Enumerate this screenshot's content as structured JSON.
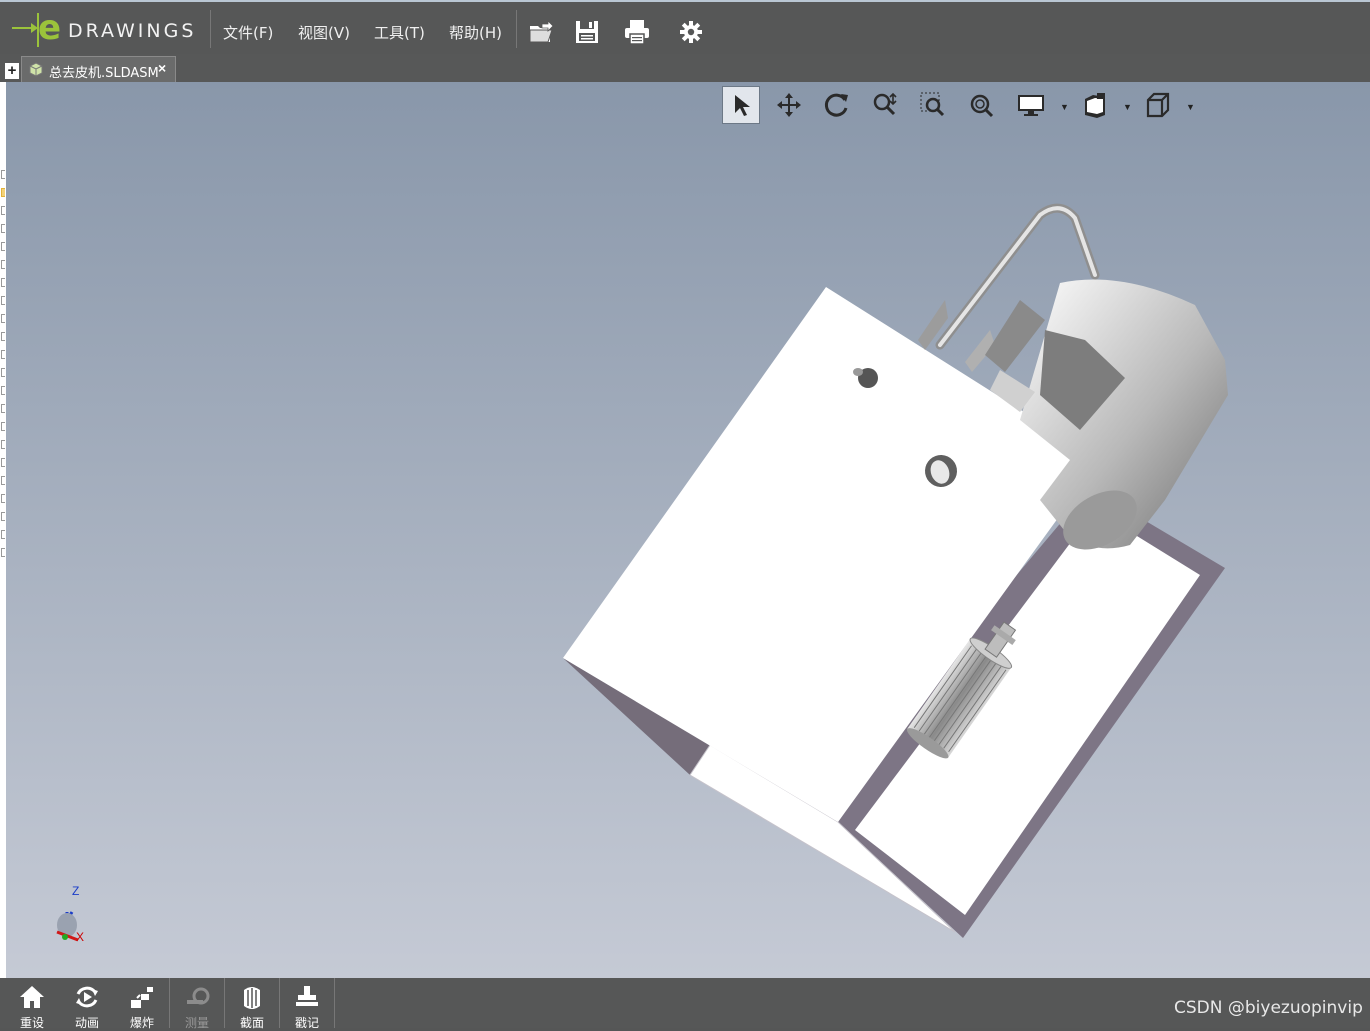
{
  "app": {
    "logo_text": "DRAWINGS"
  },
  "menu": {
    "file": "文件(F)",
    "view": "视图(V)",
    "tools": "工具(T)",
    "help": "帮助(H)"
  },
  "toolbar": {
    "icons": [
      "open-icon",
      "save-icon",
      "print-icon",
      "gear-icon"
    ]
  },
  "tabs": {
    "new_tab": "+",
    "document": "总去皮机.SLDASM",
    "close": "×"
  },
  "view_toolbar": {
    "icons": [
      "select-arrow-icon",
      "pan-icon",
      "rotate-icon",
      "zoom-icon",
      "zoom-to-area-icon",
      "zoom-to-fit-icon",
      "display-style-icon",
      "views-icon",
      "standard-view-icon"
    ]
  },
  "triad": {
    "z": "Z",
    "x": "X"
  },
  "bottom_toolbar": {
    "items": [
      {
        "label": "重设",
        "icon": "home-icon"
      },
      {
        "label": "动画",
        "icon": "animate-icon"
      },
      {
        "label": "爆炸",
        "icon": "explode-icon"
      },
      {
        "label": "测量",
        "icon": "measure-icon",
        "disabled": true
      },
      {
        "label": "截面",
        "icon": "section-icon"
      },
      {
        "label": "戳记",
        "icon": "stamp-icon"
      }
    ]
  },
  "watermark": "CSDN @biyezuopinvip"
}
